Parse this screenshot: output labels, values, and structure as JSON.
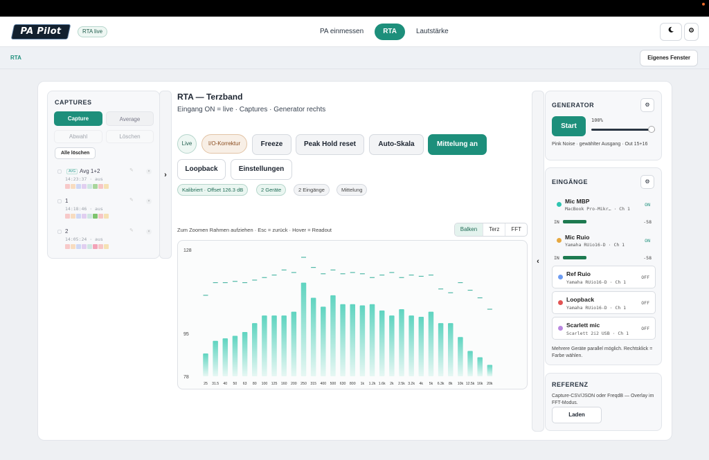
{
  "header": {
    "logo_text": "PA Pilot",
    "live_badge": "RTA live",
    "nav": [
      {
        "label": "PA einmessen"
      },
      {
        "label": "RTA"
      },
      {
        "label": "Lautstärke"
      }
    ],
    "active_nav": "RTA",
    "theme_icon": "moon-icon",
    "settings_icon": "gear-icon"
  },
  "subbar": {
    "breadcrumb": "RTA",
    "own_window_label": "Eigenes Fenster"
  },
  "captures": {
    "title": "CAPTURES",
    "tabs": [
      "Capture",
      "Average"
    ],
    "actions": [
      "Abwahl",
      "Löschen"
    ],
    "delete_all": "Alle löschen",
    "items": [
      {
        "badge": "AVG",
        "name": "Avg 1+2",
        "time": "14:23:37 · aus"
      },
      {
        "badge": "",
        "name": "1",
        "time": "14:18:46 · aus"
      },
      {
        "badge": "",
        "name": "2",
        "time": "14:05:24 · aus"
      }
    ]
  },
  "rta": {
    "title": "RTA — Terzband",
    "subtitle": "Eingang ON = live · Captures · Generator rechts",
    "status_pills": [
      "Live",
      "I/O-Korrektur"
    ],
    "buttons": [
      "Freeze",
      "Peak Hold reset",
      "Auto-Skala",
      "Mittelung an",
      "Loopback",
      "Einstellungen"
    ],
    "chips": [
      "Kalibriert · Offset 126.3 dB",
      "2 Geräte",
      "2 Eingänge",
      "Mittelung"
    ],
    "hint": "Zum Zoomen Rahmen aufziehen · Esc = zurück · Hover = Readout",
    "view_modes": [
      "Balken",
      "Terz",
      "FFT"
    ],
    "active_view": "Balken"
  },
  "chart_data": {
    "type": "bar",
    "title": "",
    "xlabel": "",
    "ylabel": "",
    "ylim": [
      78,
      128
    ],
    "y_ticks": [
      "128",
      "95",
      "78"
    ],
    "categories": [
      "25",
      "31.5",
      "40",
      "50",
      "63",
      "80",
      "100",
      "125",
      "160",
      "200",
      "250",
      "315",
      "400",
      "500",
      "630",
      "800",
      "1k",
      "1.2k",
      "1.6k",
      "2k",
      "2.5k",
      "3.2k",
      "4k",
      "5k",
      "6.3k",
      "8k",
      "10k",
      "12.5k",
      "16k",
      "20k"
    ],
    "series": [
      {
        "values": [
          87.0,
          92.0,
          93.0,
          94.0,
          95.5,
          99.0,
          102.0,
          102.0,
          102.0,
          103.5,
          115.0,
          109.0,
          105.5,
          110.0,
          106.5,
          106.5,
          106.0,
          106.5,
          104.0,
          102.0,
          104.5,
          102.0,
          101.5,
          103.5,
          99.0,
          99.0,
          93.5,
          88.0,
          85.5,
          82.5
        ]
      },
      {
        "values": [
          110.0,
          115.0,
          115.0,
          115.5,
          115.0,
          116.0,
          117.0,
          118.0,
          120.0,
          119.0,
          125.0,
          121.0,
          118.5,
          120.0,
          118.5,
          119.0,
          118.5,
          117.0,
          118.0,
          119.0,
          117.0,
          118.0,
          117.5,
          118.0,
          112.5,
          111.0,
          115.0,
          112.0,
          109.0,
          104.5
        ]
      }
    ],
    "bar_color_top": "#5fd4c0",
    "bar_color_bottom": "#e6f7f3",
    "peak_color": "#4fb8a6",
    "grid": false
  },
  "generator": {
    "title": "GENERATOR",
    "start_label": "Start",
    "volume_label": "100%",
    "volume_fraction": 1.0,
    "description": "Pink Noise · gewählter Ausgang · Out 15+16"
  },
  "inputs": {
    "title": "EINGÄNGE",
    "list": [
      {
        "name": "Mic MBP",
        "device": "MacBook Pro-Mikr… · Ch 1",
        "state": "ON",
        "color": "#2ec4b0",
        "meter_label": "IN",
        "meter_value": "-58",
        "meter_fraction": 0.85
      },
      {
        "name": "Mic Ruio",
        "device": "Yamaha RUio16-D · Ch 1",
        "state": "ON",
        "color": "#e6a840",
        "meter_label": "IN",
        "meter_value": "-58",
        "meter_fraction": 0.85
      },
      {
        "name": "Ref Ruio",
        "device": "Yamaha RUio16-D · Ch 1",
        "state": "OFF",
        "color": "#6d9cf2"
      },
      {
        "name": "Loopback",
        "device": "Yamaha RUio16-D · Ch 1",
        "state": "OFF",
        "color": "#e25454"
      },
      {
        "name": "Scarlett mic",
        "device": "Scarlett 2i2 USB · Ch 1",
        "state": "OFF",
        "color": "#b987e0"
      }
    ],
    "note": "Mehrere Geräte parallel möglich. Rechtsklick = Farbe wählen."
  },
  "reference": {
    "title": "REFERENZ",
    "description": "Capture-CSV/JSON oder FreqdB — Overlay im FFT-Modus.",
    "load_label": "Laden"
  },
  "colors": {
    "accent": "#1d8f7b"
  }
}
